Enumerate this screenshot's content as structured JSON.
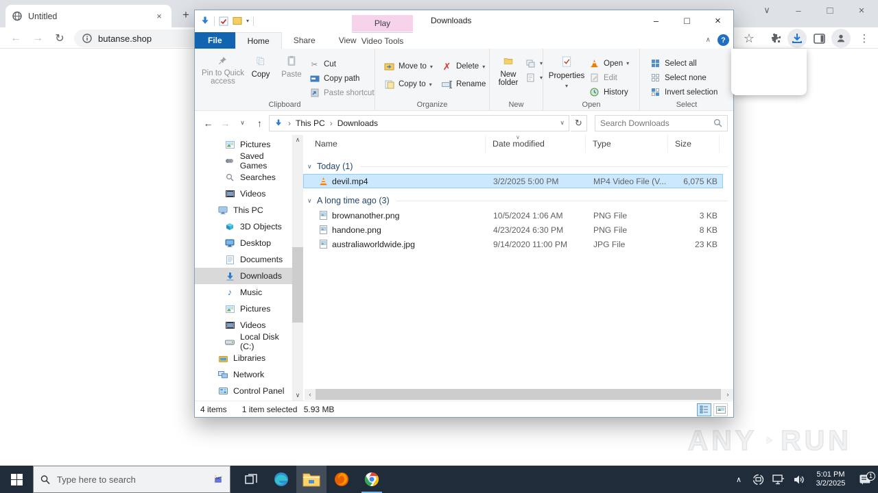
{
  "browser": {
    "tab_title": "Untitled",
    "url": "butanse.shop",
    "new_tab_glyph": "+",
    "tab_close_glyph": "×",
    "window": {
      "tab_search": "∨",
      "minimize": "–",
      "maximize": "□",
      "close": "×"
    },
    "nav": {
      "back": "←",
      "forward": "→",
      "reload": "↻"
    },
    "menu_glyph": "⋮",
    "bookmark_glyph": "☆"
  },
  "explorer": {
    "window_title": "Downloads",
    "contextual": {
      "header": "Play",
      "tab": "Video Tools"
    },
    "tabs": {
      "file": "File",
      "home": "Home",
      "share": "Share",
      "view": "View"
    },
    "ribbon_collapse_glyph": "∧",
    "help_glyph": "?",
    "window": {
      "minimize": "–",
      "maximize": "□",
      "close": "×"
    },
    "ribbon": {
      "clipboard": {
        "label": "Clipboard",
        "pin": "Pin to Quick access",
        "copy": "Copy",
        "paste": "Paste",
        "cut": "Cut",
        "copy_path": "Copy path",
        "paste_shortcut": "Paste shortcut"
      },
      "organize": {
        "label": "Organize",
        "move_to": "Move to",
        "copy_to": "Copy to",
        "delete": "Delete",
        "rename": "Rename"
      },
      "new": {
        "label": "New",
        "new_folder": "New folder"
      },
      "open": {
        "label": "Open",
        "properties": "Properties",
        "open": "Open",
        "edit": "Edit",
        "history": "History"
      },
      "select": {
        "label": "Select",
        "select_all": "Select all",
        "select_none": "Select none",
        "invert": "Invert selection"
      }
    },
    "address": {
      "crumb_root": "This PC",
      "separator": "›",
      "crumb_current": "Downloads",
      "search_placeholder": "Search Downloads"
    },
    "sidebar": {
      "items": [
        {
          "label": "Pictures",
          "icon": "pictures",
          "level": 2
        },
        {
          "label": "Saved Games",
          "icon": "saved-games",
          "level": 2
        },
        {
          "label": "Searches",
          "icon": "searches",
          "level": 2
        },
        {
          "label": "Videos",
          "icon": "videos",
          "level": 2
        },
        {
          "label": "This PC",
          "icon": "this-pc",
          "level": 1
        },
        {
          "label": "3D Objects",
          "icon": "objects-3d",
          "level": 2
        },
        {
          "label": "Desktop",
          "icon": "desktop",
          "level": 2
        },
        {
          "label": "Documents",
          "icon": "documents",
          "level": 2
        },
        {
          "label": "Downloads",
          "icon": "downloads",
          "level": 2,
          "selected": true
        },
        {
          "label": "Music",
          "icon": "music",
          "level": 2
        },
        {
          "label": "Pictures",
          "icon": "pictures",
          "level": 2
        },
        {
          "label": "Videos",
          "icon": "videos",
          "level": 2
        },
        {
          "label": "Local Disk (C:)",
          "icon": "local-disk",
          "level": 2
        },
        {
          "label": "Libraries",
          "icon": "libraries",
          "level": 1
        },
        {
          "label": "Network",
          "icon": "network",
          "level": 1
        },
        {
          "label": "Control Panel",
          "icon": "control-panel",
          "level": 1
        }
      ]
    },
    "list": {
      "columns": [
        "Name",
        "Date modified",
        "Type",
        "Size"
      ],
      "groups": [
        {
          "label": "Today (1)",
          "files": [
            {
              "name": "devil.mp4",
              "icon": "vlc",
              "date": "3/2/2025 5:00 PM",
              "type": "MP4 Video File (V...",
              "size": "6,075 KB",
              "selected": true
            }
          ]
        },
        {
          "label": "A long time ago (3)",
          "files": [
            {
              "name": "brownanother.png",
              "icon": "image",
              "date": "10/5/2024 1:06 AM",
              "type": "PNG File",
              "size": "3 KB"
            },
            {
              "name": "handone.png",
              "icon": "image",
              "date": "4/23/2024 6:30 PM",
              "type": "PNG File",
              "size": "8 KB"
            },
            {
              "name": "australiaworldwide.jpg",
              "icon": "image",
              "date": "9/14/2020 11:00 PM",
              "type": "JPG File",
              "size": "23 KB"
            }
          ]
        }
      ]
    },
    "status": {
      "items": "4 items",
      "selected": "1 item selected",
      "size": "5.93 MB"
    }
  },
  "watermark": {
    "left": "ANY",
    "right": "RUN"
  },
  "taskbar": {
    "search_placeholder": "Type here to search",
    "clock": {
      "time": "5:01 PM",
      "date": "3/2/2025"
    },
    "notification_count": "1"
  }
}
